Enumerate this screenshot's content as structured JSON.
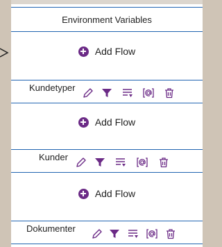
{
  "header": {
    "title": "Environment Variables"
  },
  "add_flow_label": "Add Flow",
  "steps": [
    {
      "label": "Kundetyper"
    },
    {
      "label": "Kunder"
    },
    {
      "label": "Dokumenter"
    }
  ],
  "icons": {
    "edit": "pencil-icon",
    "filter": "filter-icon",
    "sort": "list-sort-icon",
    "variable": "at-variable-icon",
    "delete": "trash-icon"
  },
  "colors": {
    "accent": "#6b2a86",
    "border": "#1f63b0"
  }
}
